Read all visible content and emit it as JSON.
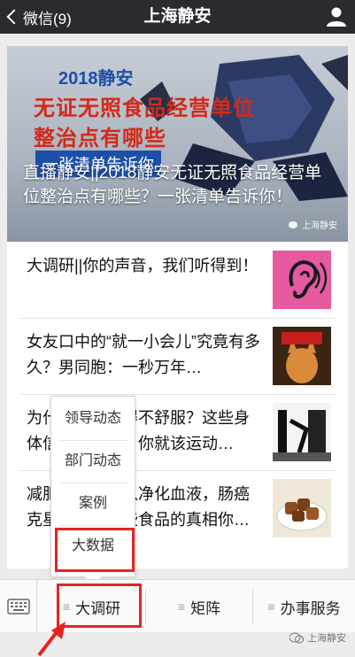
{
  "nav": {
    "back_label": "微信(9)",
    "title": "上海静安"
  },
  "hero": {
    "year": "2018静安",
    "title_line1": "无证无照食品经营单位",
    "title_line2": "整治点有哪些",
    "tag": "一张清单告诉你",
    "caption": "直播静安||2018静安无证无照食品经营单位整治点有哪些？一张清单告诉你！",
    "watermark": "上海静安"
  },
  "articles": [
    {
      "title": "大调研||你的声音，我们听得到！",
      "thumb_icon": "ear-icon"
    },
    {
      "title": "女友口中的“就一小会儿”究竟有多久？男同胞：一秒万年…",
      "thumb_icon": "cat-icon"
    },
    {
      "title": "为什么我总觉得不舒服？这些身体信号出现时，你就该运动…",
      "thumb_icon": "chair-icon"
    },
    {
      "title": "减肥神器？可以净化血液，肠癌克星…关于这些食品的真相你…",
      "thumb_icon": "food-icon"
    }
  ],
  "popup_menu": {
    "items": [
      "领导动态",
      "部门动态",
      "案例",
      "大数据"
    ],
    "highlighted": "大数据"
  },
  "bottom_menu": {
    "tabs": [
      "大调研",
      "矩阵",
      "办事服务"
    ],
    "active": "大调研"
  },
  "footer": {
    "watermark": "上海静安"
  },
  "colors": {
    "nav_bg": "#2a2b2f",
    "highlight": "#e8231f",
    "hero_red": "#d22a1a",
    "hero_blue": "#1d4fa8"
  }
}
